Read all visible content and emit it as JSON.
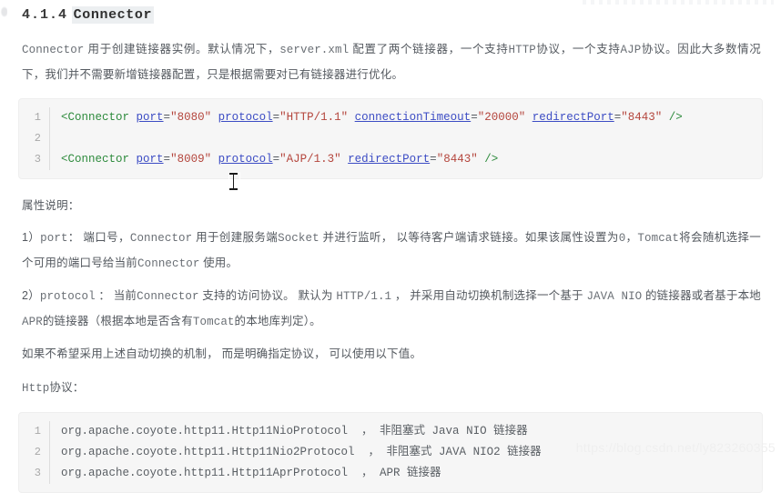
{
  "heading": {
    "number": "4.1.4",
    "title": "Connector"
  },
  "paragraphs": {
    "intro": {
      "seg1": "Connector",
      "seg2": " 用于创建链接器实例。默认情况下，",
      "seg3": "server.xml",
      "seg4": " 配置了两个链接器，一个支持",
      "seg5": "HTTP",
      "seg6": "协议，一个支持",
      "seg7": "AJP",
      "seg8": "协议。因此大多数情况下，我们并不需要新增链接器配置，只是根据需要对已有链接器进行优化。"
    },
    "attrs_label": "属性说明：",
    "item1": {
      "seg1": "1）",
      "seg2": "port",
      "seg3": "： 端口号，",
      "seg4": "Connector",
      "seg5": " 用于创建服务端",
      "seg6": "Socket",
      "seg7": " 并进行监听， 以等待客户端请求链接。如果该属性设置为",
      "seg8": "0",
      "seg9": "，",
      "seg10": "Tomcat",
      "seg11": "将会随机选择一个可用的端口号给当前",
      "seg12": "Connector",
      "seg13": " 使用。"
    },
    "item2": {
      "seg1": "2）",
      "seg2": "protocol",
      "seg3": " ： 当前",
      "seg4": "Connector",
      "seg5": " 支持的访问协议。 默认为 ",
      "seg6": "HTTP/1.1",
      "seg7": " ， 并采用自动切换机制选择一个基于 ",
      "seg8": "JAVA NIO",
      "seg9": " 的链接器或者基于本地",
      "seg10": "APR",
      "seg11": "的链接器（根据本地是否含有",
      "seg12": "Tomcat",
      "seg13": "的本地库判定）。"
    },
    "note": "如果不希望采用上述自动切换的机制， 而是明确指定协议， 可以使用以下值。",
    "http_label": {
      "seg1": "Http",
      "seg2": "协议："
    }
  },
  "code_block_xml": {
    "lines": [
      {
        "number": "1",
        "tokens": [
          {
            "t": "tag",
            "v": "<Connector"
          },
          {
            "t": "plain",
            "v": " "
          },
          {
            "t": "attr",
            "v": "port"
          },
          {
            "t": "eq",
            "v": "="
          },
          {
            "t": "str",
            "v": "\"8080\""
          },
          {
            "t": "plain",
            "v": " "
          },
          {
            "t": "attr",
            "v": "protocol"
          },
          {
            "t": "eq",
            "v": "="
          },
          {
            "t": "str",
            "v": "\"HTTP/1.1\""
          },
          {
            "t": "plain",
            "v": " "
          },
          {
            "t": "attr",
            "v": "connectionTimeout"
          },
          {
            "t": "eq",
            "v": "="
          },
          {
            "t": "str",
            "v": "\"20000\""
          },
          {
            "t": "plain",
            "v": " "
          },
          {
            "t": "attr",
            "v": "redirectPort"
          },
          {
            "t": "eq",
            "v": "="
          },
          {
            "t": "str",
            "v": "\"8443\""
          },
          {
            "t": "plain",
            "v": " "
          },
          {
            "t": "close",
            "v": "/>"
          }
        ]
      },
      {
        "number": "2",
        "tokens": []
      },
      {
        "number": "3",
        "tokens": [
          {
            "t": "tag",
            "v": "<Connector"
          },
          {
            "t": "plain",
            "v": " "
          },
          {
            "t": "attr",
            "v": "port"
          },
          {
            "t": "eq",
            "v": "="
          },
          {
            "t": "str",
            "v": "\"8009\""
          },
          {
            "t": "plain",
            "v": " "
          },
          {
            "t": "attr",
            "v": "protocol"
          },
          {
            "t": "eq",
            "v": "="
          },
          {
            "t": "str",
            "v": "\"AJP/1.3\""
          },
          {
            "t": "plain",
            "v": " "
          },
          {
            "t": "attr",
            "v": "redirectPort"
          },
          {
            "t": "eq",
            "v": "="
          },
          {
            "t": "str",
            "v": "\"8443\""
          },
          {
            "t": "plain",
            "v": " "
          },
          {
            "t": "close",
            "v": "/>"
          }
        ]
      }
    ]
  },
  "code_block_protocols": {
    "lines": [
      {
        "number": "1",
        "text": "org.apache.coyote.http11.Http11NioProtocol  ， 非阻塞式 Java NIO 链接器"
      },
      {
        "number": "2",
        "text": "org.apache.coyote.http11.Http11Nio2Protocol  ， 非阻塞式 JAVA NIO2 链接器"
      },
      {
        "number": "3",
        "text": "org.apache.coyote.http11.Http11AprProtocol  ， APR 链接器"
      }
    ]
  },
  "watermark": "https://blog.csdn.net/ly823260355"
}
